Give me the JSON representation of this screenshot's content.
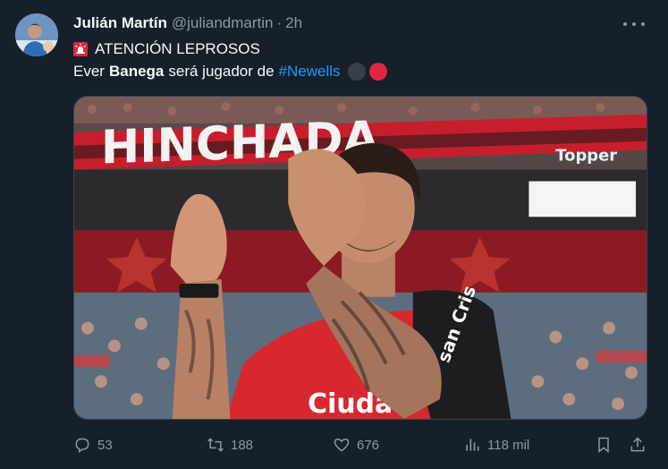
{
  "author": {
    "name": "Julián Martín",
    "handle": "@juliandmartin",
    "separator": "·",
    "time": "2h"
  },
  "tweet": {
    "line1": "ATENCIÓN LEPROSOS",
    "line2_start": "Ever",
    "line2_bold": "Banega",
    "line2_mid": "será jugador de",
    "hashtag": "#Newells"
  },
  "media": {
    "banner_text": "HINCHADA",
    "sponsor": "Topper",
    "shirt_text": "Ciudad"
  },
  "actions": {
    "replies": "53",
    "retweets": "188",
    "likes": "676",
    "views": "118 mil"
  },
  "icons": [
    "siren-icon",
    "more-icon",
    "reply-icon",
    "retweet-icon",
    "like-icon",
    "views-icon",
    "bookmark-icon",
    "share-icon"
  ],
  "colors": {
    "background": "#15202b",
    "accent": "#1d9bf0",
    "muted": "#8b98a5",
    "newells_red": "#e0263e",
    "newells_black": "#3a3f44"
  }
}
